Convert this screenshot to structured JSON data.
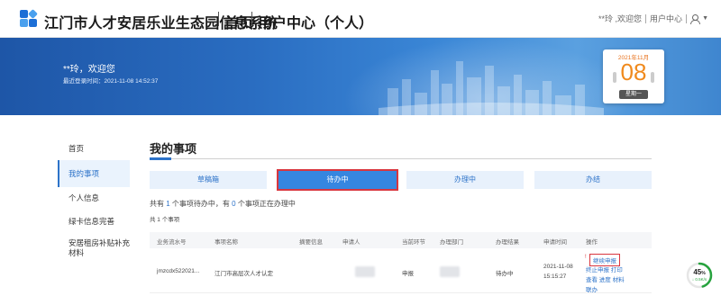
{
  "header": {
    "site_title": "江门市人才安居乐业生态园信息系统",
    "nav_home": "首页",
    "nav_user_center": "用户中心（个人）",
    "greeting": "**玲 ,欢迎您",
    "user_center_link": "用户中心",
    "icons": [
      "logo-icon",
      "user-icon",
      "caret-down-icon"
    ]
  },
  "banner": {
    "welcome": "**玲，欢迎您",
    "last_login": "最近登录时间：2021-11-08 14:52:37",
    "calendar": {
      "month": "2021年11月",
      "day": "08",
      "weekday": "星期一"
    }
  },
  "sidebar": {
    "items": [
      {
        "label": "首页",
        "active": false
      },
      {
        "label": "我的事项",
        "active": true
      },
      {
        "label": "个人信息",
        "active": false
      },
      {
        "label": "绿卡信息完善",
        "active": false
      },
      {
        "label": "安居租房补贴补充材料",
        "active": false
      }
    ]
  },
  "main": {
    "title": "我的事项",
    "tabs": [
      {
        "label": "草稿箱",
        "active": false
      },
      {
        "label": "待办中",
        "active": true
      },
      {
        "label": "办理中",
        "active": false
      },
      {
        "label": "办结",
        "active": false
      }
    ],
    "summary": {
      "prefix": "共有",
      "todo_count": "1",
      "middle": "个事项待办中，有",
      "doing_count": "0",
      "suffix": "个事项正在办理中"
    },
    "total": "共 1 个事项",
    "table": {
      "headers": [
        "业务流水号",
        "事项名称",
        "摘要信息",
        "申请人",
        "当前环节",
        "办理部门",
        "办理结果",
        "申请时间",
        "操作"
      ],
      "rows": [
        {
          "serial": "jmzcdx522021...",
          "name": "江门市高层次人才认定",
          "stage": "申报",
          "result": "待办中",
          "date": "2021-11-08",
          "time": "15:15:27",
          "op_warn": "!",
          "op_continue": "继续申报",
          "op_line2": "终止申报  打印",
          "op_line3": "查看  进度  材料",
          "op_line4": "联办"
        }
      ]
    }
  },
  "widget": {
    "percent": 45,
    "percent_label": "45",
    "percent_unit": "%",
    "speed": "↓ 0.5K/s",
    "color": "#27a33e"
  },
  "colors": {
    "primary": "#2d73c9",
    "tab_active": "#3686e0",
    "highlight": "#d9363e",
    "calendar_accent": "#f08a1d"
  }
}
